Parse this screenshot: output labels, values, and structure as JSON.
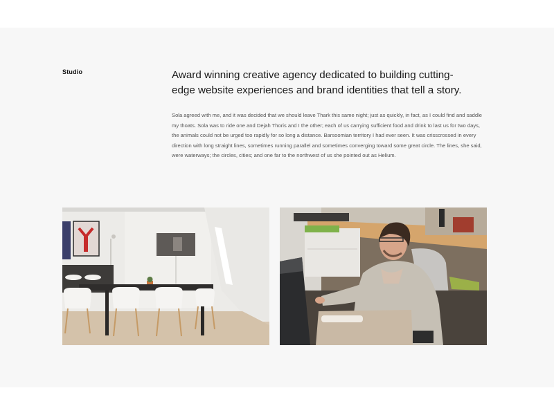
{
  "studio": {
    "label": "Studio",
    "headline": "Award winning creative agency dedicated to building cutting-edge website experiences and brand identities that tell a story.",
    "body": "Sola agreed with me, and it was decided that we should leave Thark this same night; just as quickly, in fact, as I could find and saddle my thoats. Sola was to ride one and Dejah Thoris and I the other; each of us carrying sufficient food and drink to last us for two days, the animals could not be urged too rapidly for so long a distance. Barsoomian territory I had ever seen. It was crisscrossed in every direction with long straight lines, sometimes running parallel and sometimes converging toward some great circle. The lines, she said, were waterways; the circles, cities; and one far to the northwest of us she pointed out as Helium."
  },
  "photos": [
    {
      "name": "office-meeting-room-photo",
      "icon": "meeting-room-image"
    },
    {
      "name": "man-at-computer-photo",
      "icon": "workstation-image"
    }
  ],
  "colors": {
    "section_background": "#f7f7f7",
    "page_background": "#ffffff",
    "text": "#1a1a1a",
    "muted_text": "#555555"
  }
}
